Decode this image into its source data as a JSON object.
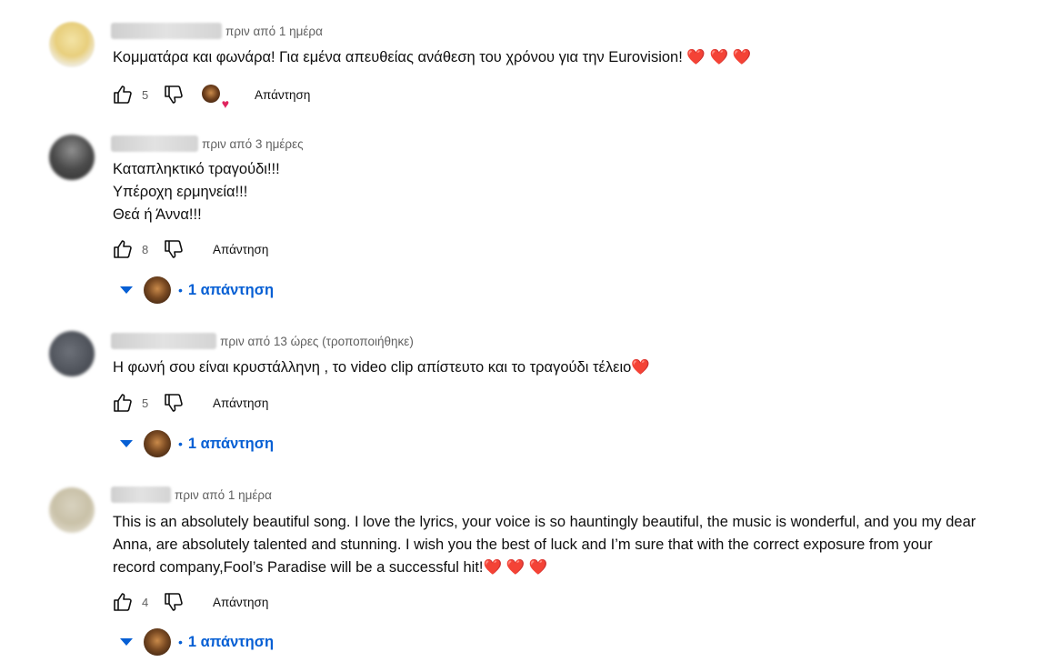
{
  "comments": [
    {
      "time": "πριν από 1 ημέρα",
      "text": "Κομματάρα και φωνάρα! Για εμένα απευθείας ανάθεση του χρόνου για την Eurovision! ❤️ ❤️ ❤️",
      "likes": "5",
      "reply_label": "Απάντηση"
    },
    {
      "time": "πριν από 3 ημέρες",
      "text": "Καταπληκτικό τραγούδι!!!\nΥπέροχη ερμηνεία!!!\nΘεά ή Άννα!!!",
      "likes": "8",
      "reply_label": "Απάντηση",
      "replies_label": "1 απάντηση"
    },
    {
      "time": "πριν από 13 ώρες (τροποποιήθηκε)",
      "text": "Η φωνή σου είναι κρυστάλληνη , το video clip απίστευτο και το τραγούδι τέλειο❤️",
      "likes": "5",
      "reply_label": "Απάντηση",
      "replies_label": "1 απάντηση"
    },
    {
      "time": "πριν από 1 ημέρα",
      "text": "This is an absolutely beautiful song. I love the lyrics, your voice is so hauntingly beautiful, the music is wonderful, and you my dear\nAnna, are absolutely talented and stunning. I wish you the best of luck and I’m sure that with the correct exposure from your\nrecord company,Fool’s Paradise will be a successful hit!❤️ ❤️ ❤️",
      "likes": "4",
      "reply_label": "Απάντηση",
      "replies_label": "1 απάντηση"
    }
  ],
  "icons": {
    "like": "thumbs-up-icon",
    "dislike": "thumbs-down-icon",
    "creator_heart": "heart-icon",
    "expand": "caret-down-icon"
  },
  "colors": {
    "link_blue": "#065fd4",
    "heart_red": "#e0245e",
    "meta_gray": "#606060"
  }
}
